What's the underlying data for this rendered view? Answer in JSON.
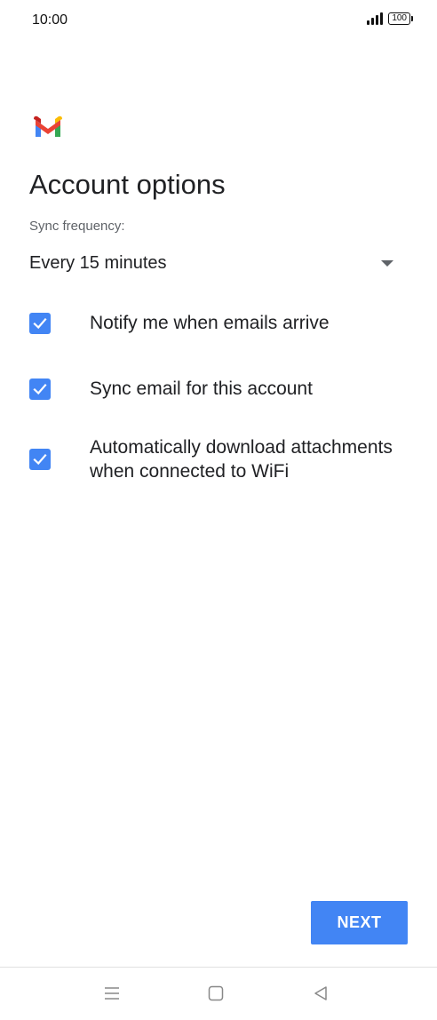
{
  "status_bar": {
    "time": "10:00",
    "battery": "100"
  },
  "header": {
    "title": "Account options"
  },
  "sync": {
    "label": "Sync frequency:",
    "value": "Every 15 minutes"
  },
  "options": [
    {
      "label": "Notify me when emails arrive",
      "checked": true
    },
    {
      "label": "Sync email for this account",
      "checked": true
    },
    {
      "label": "Automatically download attachments when connected to WiFi",
      "checked": true
    }
  ],
  "footer": {
    "next_label": "NEXT"
  },
  "colors": {
    "accent": "#4285f4",
    "text_primary": "#202124",
    "text_secondary": "#5f6368"
  },
  "icons": {
    "logo": "gmail-logo",
    "signal": "signal-icon",
    "battery": "battery-icon",
    "dropdown": "dropdown-arrow-icon",
    "check": "checkmark-icon",
    "nav_menu": "menu-icon",
    "nav_home": "home-icon",
    "nav_back": "back-icon"
  }
}
